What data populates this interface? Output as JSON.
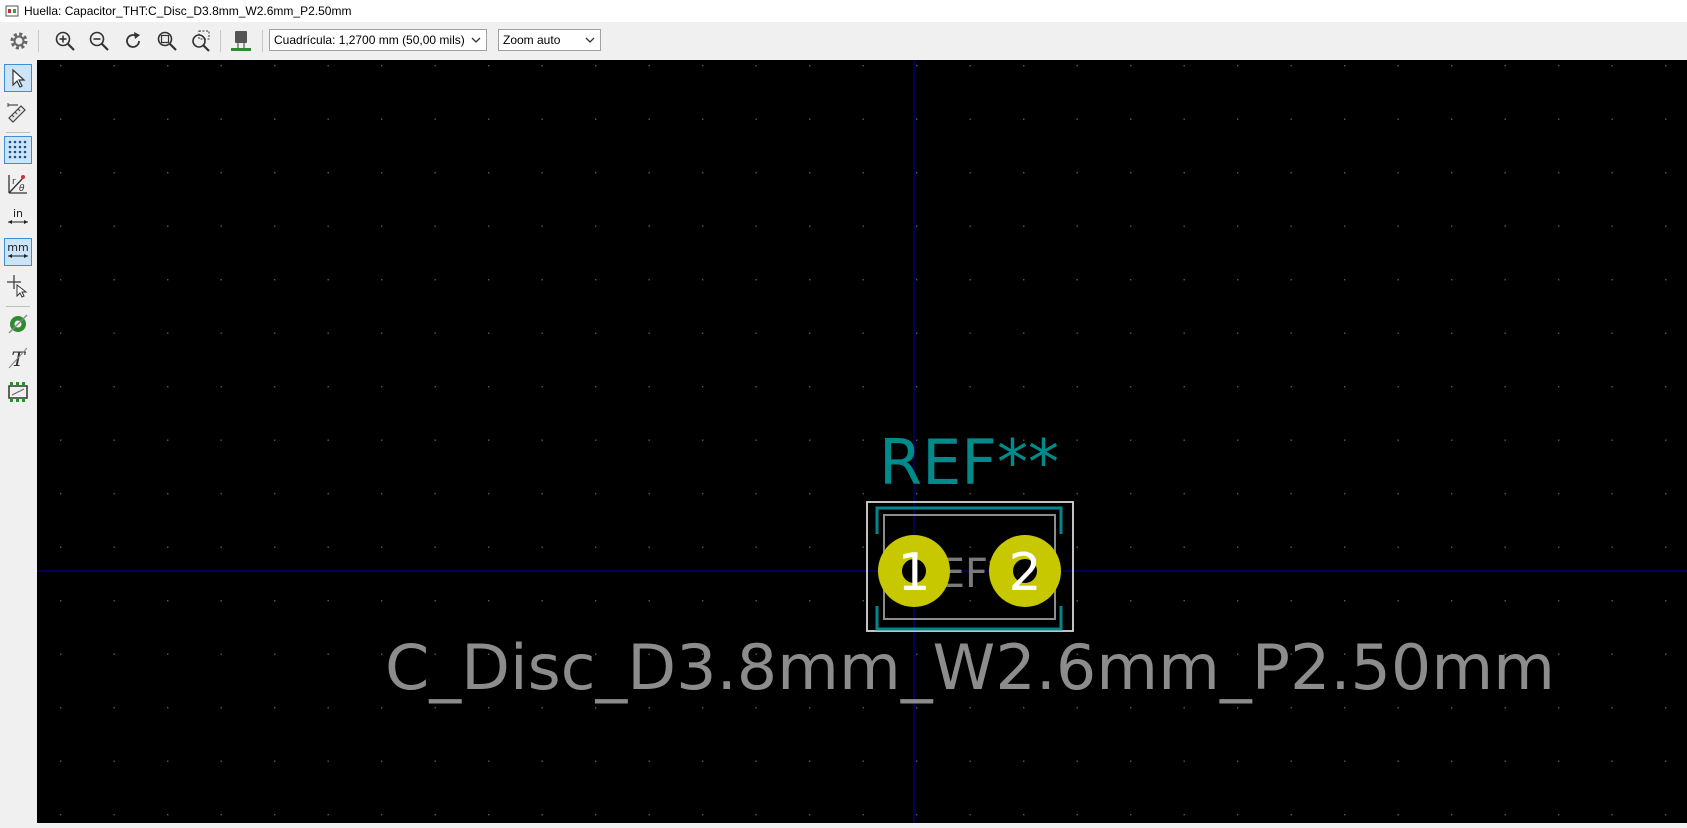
{
  "window": {
    "title": "Huella: Capacitor_THT:C_Disc_D3.8mm_W2.6mm_P2.50mm"
  },
  "toolbar": {
    "grid_select": "Cuadrícula: 1,2700 mm (50,00 mils)",
    "zoom_select": "Zoom auto",
    "icons": [
      "gear-icon",
      "zoom-in-icon",
      "zoom-out-icon",
      "redraw-icon",
      "zoom-fit-icon",
      "zoom-selection-icon",
      "3d-viewer-icon"
    ]
  },
  "left_toolbar": {
    "icons": [
      "select-icon",
      "measure-icon",
      "grid-icon",
      "polar-coords-icon",
      "inch-units-icon",
      "mm-units-icon",
      "cursor-shape-icon",
      "pad-display-icon",
      "text-display-icon",
      "graphic-outline-icon"
    ],
    "inch_label": "in",
    "mm_label": "mm"
  },
  "footprint": {
    "reference": "REF**",
    "value": "C_Disc_D3.8mm_W2.6mm_P2.50mm",
    "fab_reference": "REF**",
    "pad1": "1",
    "pad2": "2"
  },
  "colors": {
    "canvas_bg": "#000000",
    "reference_text": "#008b8b",
    "value_text": "#8c8c8c",
    "pad": "#c8c800",
    "silkscreen": "#00868b",
    "axis": "#0000a8",
    "grid_dot": "#5a5a5a"
  }
}
